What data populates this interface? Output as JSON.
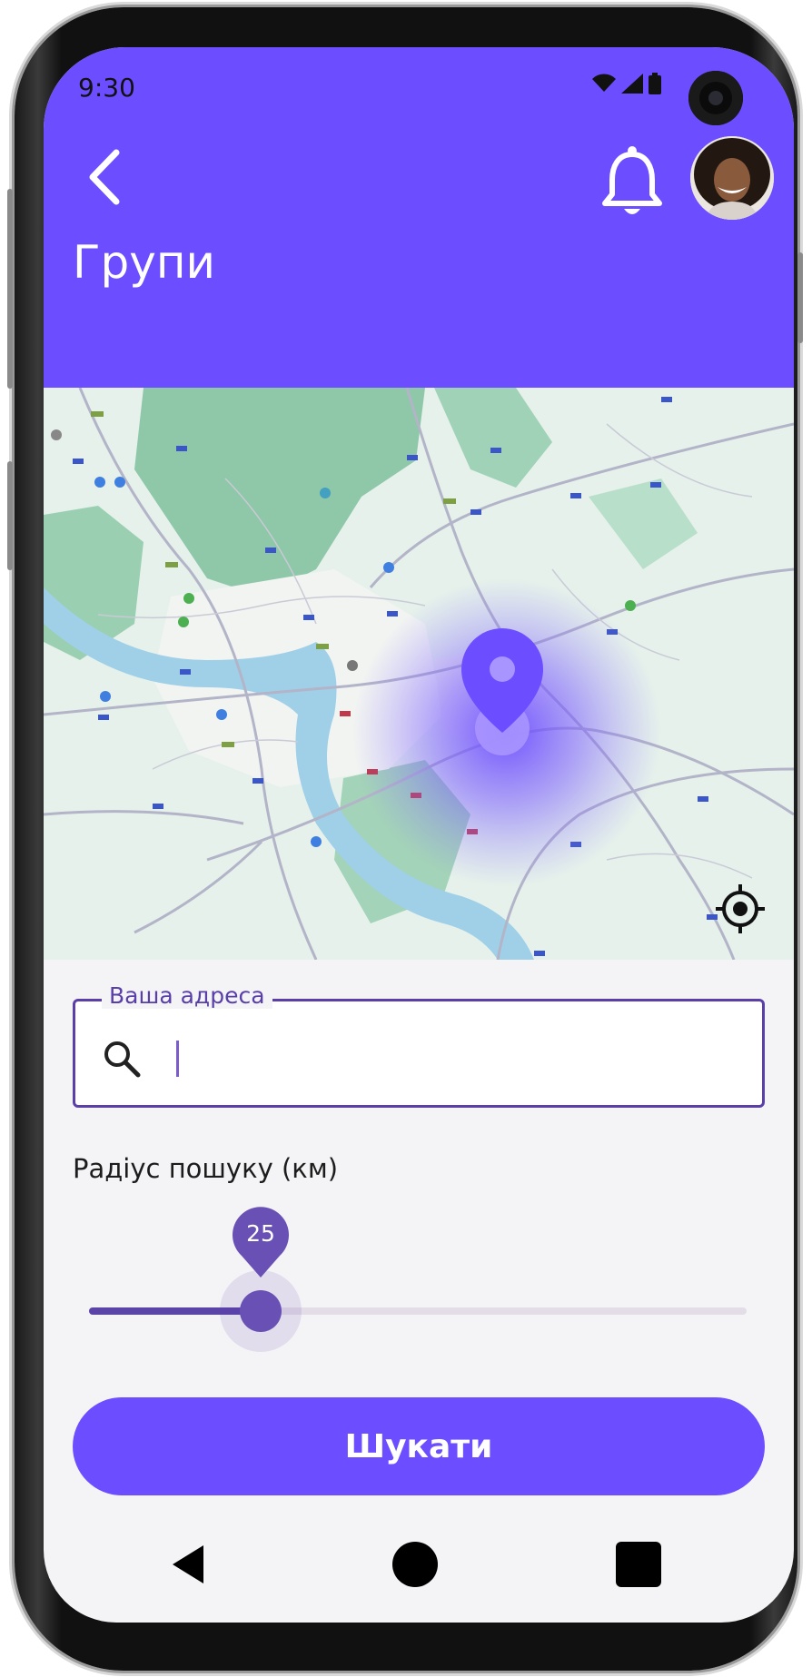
{
  "status_bar": {
    "time": "9:30"
  },
  "header": {
    "title": "Групи"
  },
  "search": {
    "label": "Ваша адреса",
    "value": ""
  },
  "radius": {
    "label": "Радіус пошуку (км)",
    "value": "25",
    "min": 0,
    "max": 100
  },
  "actions": {
    "search_label": "Шукати"
  },
  "icons": {
    "back": "chevron-left-icon",
    "notifications": "bell-icon",
    "avatar": "user-avatar",
    "location_pin": "map-pin-icon",
    "my_location": "crosshair-icon",
    "search": "magnifier-icon"
  },
  "colors": {
    "primary": "#6c4dff",
    "accent": "#5a3fa8",
    "map_land": "#e7f2ec",
    "map_water": "#9fd0e8",
    "map_forest": "#8fc7a9"
  }
}
